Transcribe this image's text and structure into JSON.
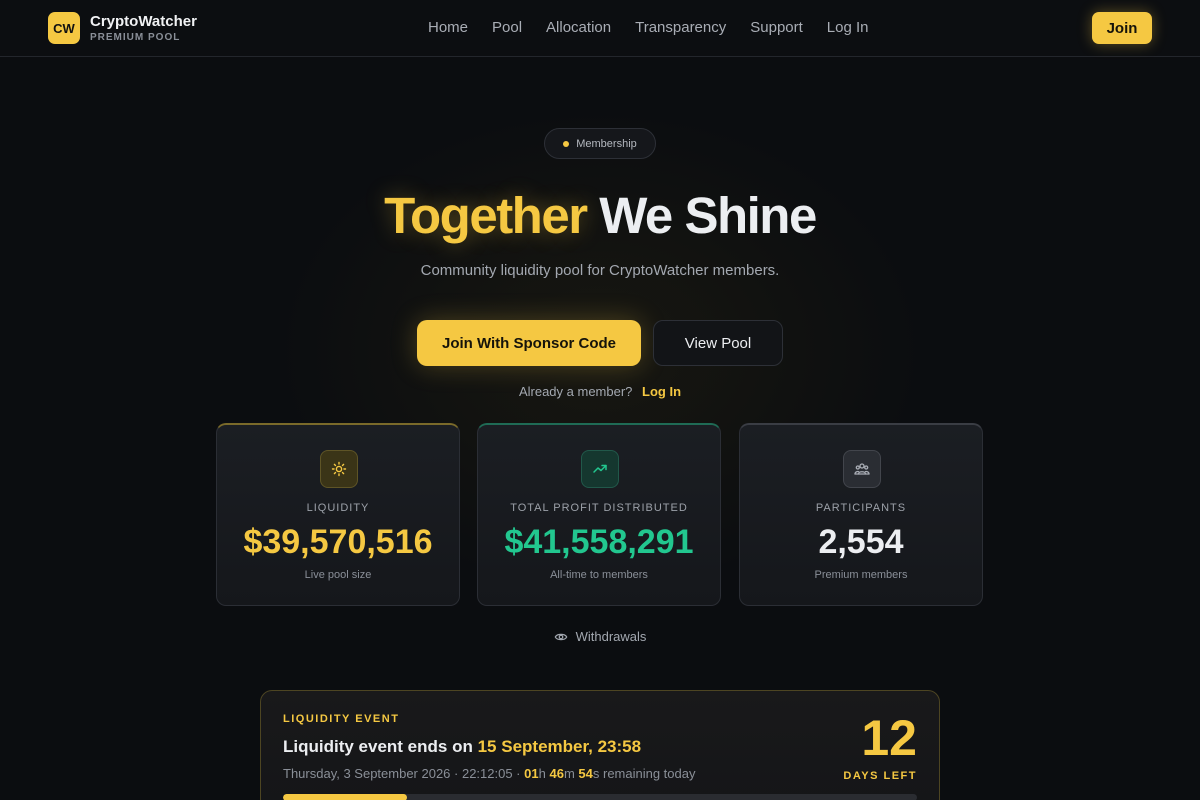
{
  "brand": {
    "logo": "CW",
    "name": "CryptoWatcher",
    "subtitle": "PREMIUM POOL"
  },
  "nav": {
    "links": [
      "Home",
      "Pool",
      "Allocation",
      "Transparency",
      "Support",
      "Log In"
    ],
    "join_label": "Join"
  },
  "hero": {
    "pill": "Membership",
    "headline_highlight": "Together",
    "headline_rest": "We Shine",
    "subline": "Community liquidity pool for CryptoWatcher members.",
    "primary_cta": "Join With Sponsor Code",
    "secondary_cta": "View Pool",
    "member_prompt": "Already a member?",
    "member_link": "Log In"
  },
  "stats": [
    {
      "icon": "sun-icon",
      "label": "LIQUIDITY",
      "value": "$39,570,516",
      "note": "Live pool size"
    },
    {
      "icon": "trending-up-icon",
      "label": "TOTAL PROFIT DISTRIBUTED",
      "value": "$41,558,291",
      "note": "All-time to members"
    },
    {
      "icon": "users-icon",
      "label": "PARTICIPANTS",
      "value": "2,554",
      "note": "Premium members"
    }
  ],
  "withdrawals_label": "Withdrawals",
  "event": {
    "tag": "LIQUIDITY EVENT",
    "title_prefix": "Liquidity event ends on",
    "title_date": "15 September, 23:58",
    "meta_date": "Thursday, 3 September 2026 · 22:12:05 ·",
    "hours": "01",
    "hours_unit": "h",
    "minutes": "46",
    "minutes_unit": "m",
    "seconds": "54",
    "seconds_unit": "s remaining today",
    "days_left": "12",
    "days_label": "DAYS LEFT",
    "progress_fraction": 0.195
  },
  "colors": {
    "accent": "#f5c842",
    "profit": "#22c78f",
    "background": "#0b0d10"
  }
}
